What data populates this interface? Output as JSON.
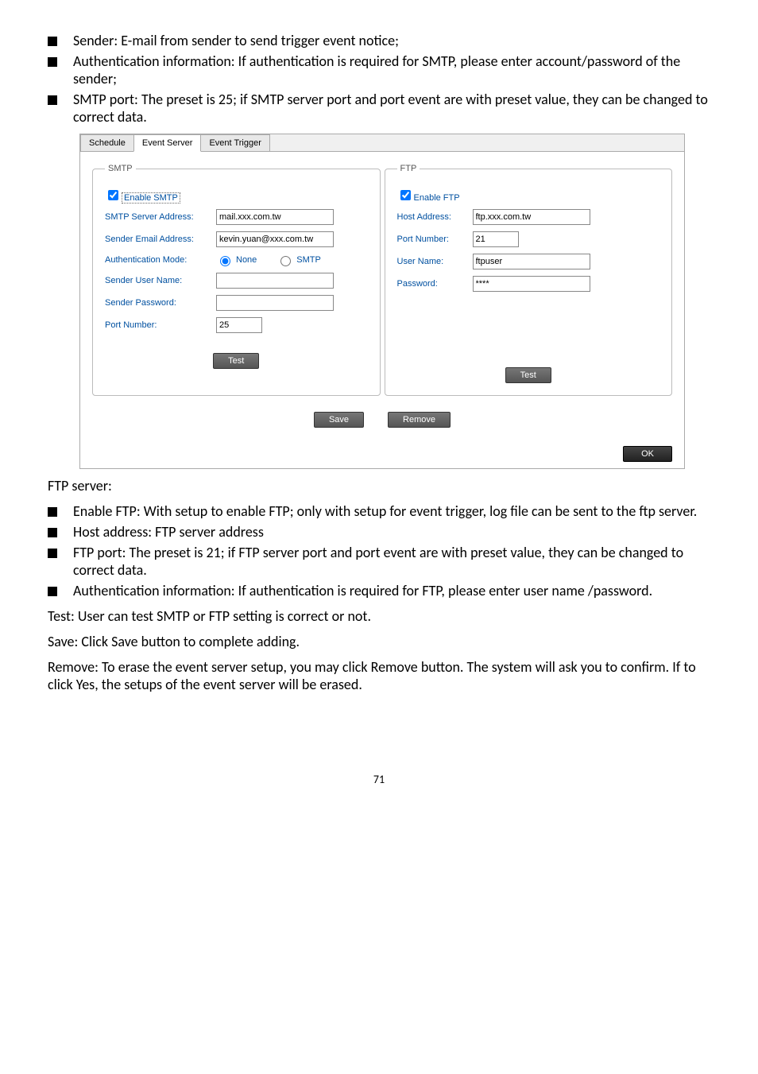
{
  "bullets_top": [
    "Sender: E-mail from sender to send trigger event notice;",
    "Authentication information: If authentication is required for SMTP, please enter account/password of the sender;",
    "SMTP port: The preset is 25; if SMTP server port and port event are with preset value, they can be changed to correct data."
  ],
  "screenshot": {
    "tabs": [
      "Schedule",
      "Event Server",
      "Event Trigger"
    ],
    "smtp": {
      "legend": "SMTP",
      "enable_label": "Enable SMTP",
      "rows": {
        "server_addr_label": "SMTP Server Address:",
        "server_addr_value": "mail.xxx.com.tw",
        "sender_email_label": "Sender Email Address:",
        "sender_email_value": "kevin.yuan@xxx.com.tw",
        "auth_mode_label": "Authentication Mode:",
        "auth_none": "None",
        "auth_smtp": "SMTP",
        "sender_user_label": "Sender User Name:",
        "sender_pass_label": "Sender Password:",
        "port_label": "Port Number:",
        "port_value": "25"
      },
      "test_btn": "Test"
    },
    "ftp": {
      "legend": "FTP",
      "enable_label": "Enable FTP",
      "rows": {
        "host_label": "Host Address:",
        "host_value": "ftp.xxx.com.tw",
        "port_label": "Port Number:",
        "port_value": "21",
        "user_label": "User Name:",
        "user_value": "ftpuser",
        "pass_label": "Password:",
        "pass_value": "****"
      },
      "test_btn": "Test"
    },
    "save_btn": "Save",
    "remove_btn": "Remove",
    "ok_btn": "OK"
  },
  "ftp_server_heading": "FTP server:",
  "bullets_ftp": [
    "Enable FTP: With setup to enable FTP; only with setup for event trigger, log file can be sent to the ftp server.",
    "Host address: FTP server address",
    "FTP port: The preset is 21; if FTP server port and port event are with preset value, they can be changed to correct data.",
    "Authentication information: If authentication is required for FTP, please enter user name /password."
  ],
  "para_test": "Test: User can test SMTP or FTP setting is correct or not.",
  "para_save": "Save: Click Save button to complete adding.",
  "para_remove": "Remove: To erase the event server setup, you may click Remove button. The system will ask you to confirm. If to click Yes, the setups of the event server will be erased.",
  "page_number": "71"
}
